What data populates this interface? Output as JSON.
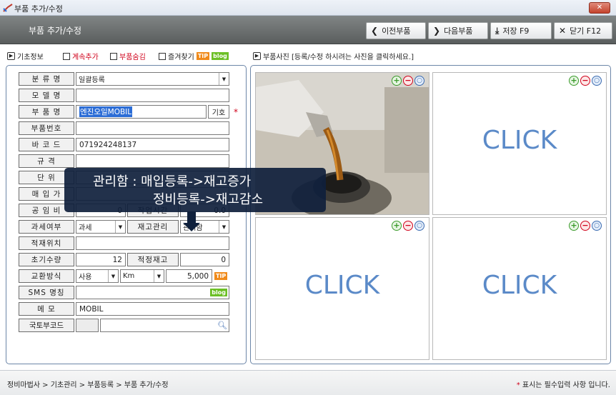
{
  "window": {
    "title": "부품 추가/수정",
    "close_label": "✕"
  },
  "header": {
    "title": "부품 추가/수정",
    "buttons": {
      "prev": "이전부품",
      "next": "다음부품",
      "save": "저장 F9",
      "close": "닫기 F12"
    }
  },
  "options": {
    "basic_info": "기초정보",
    "continue_add": "계속추가",
    "hide_part": "부품숨김",
    "favorites": "즐겨찾기",
    "tip_badge": "TIP",
    "blog_badge": "blog",
    "photo_label": "부품사진 [등록/수정 하시려는 사진을 클릭하세요.]"
  },
  "form": {
    "category_label": "분 류 명",
    "category_value": "일괄등록",
    "model_label": "모 델 명",
    "model_value": "",
    "name_label": "부 품 명",
    "name_value": "엔진오일MOBIL",
    "symbol_button": "기호",
    "part_number_label": "부품번호",
    "part_number_value": "",
    "barcode_label": "바 코 드",
    "barcode_value": "071924248137",
    "spec_label": "규 격",
    "unit_label": "단 위",
    "purchase_label": "매 입 가",
    "labor_label": "공 임 비",
    "labor_value": "0",
    "work_time_label": "작업시간",
    "work_time_value": "0.0",
    "tax_label": "과세여부",
    "tax_value": "과세",
    "stock_mgmt_label": "재고관리",
    "stock_mgmt_value": "관리함",
    "location_label": "적재위치",
    "location_value": "",
    "initial_qty_label": "초기수량",
    "initial_qty_value": "12",
    "proper_stock_label": "적정재고",
    "proper_stock_value": "0",
    "exchange_label": "교환방식",
    "exchange_use_value": "사용",
    "exchange_unit_value": "Km",
    "exchange_amount_value": "5,000",
    "sms_label": "SMS 명칭",
    "sms_value": "",
    "memo_label": "메 모",
    "memo_value": "MOBIL",
    "national_code_label": "국토부코드",
    "national_code_value": ""
  },
  "photos": {
    "click_text": "CLICK"
  },
  "tooltip": {
    "line1": "관리함 : 매입등록->재고증가",
    "line2": "정비등록->재고감소"
  },
  "status": {
    "breadcrumb": "정비마법사 > 기초관리 > 부품등록 > 부품 추가/수정",
    "required_note": "표시는 필수입력 사항 입니다."
  },
  "colors": {
    "required": "#d0021b",
    "accent": "#2c6dd6",
    "click_text": "#5b8ac8"
  }
}
